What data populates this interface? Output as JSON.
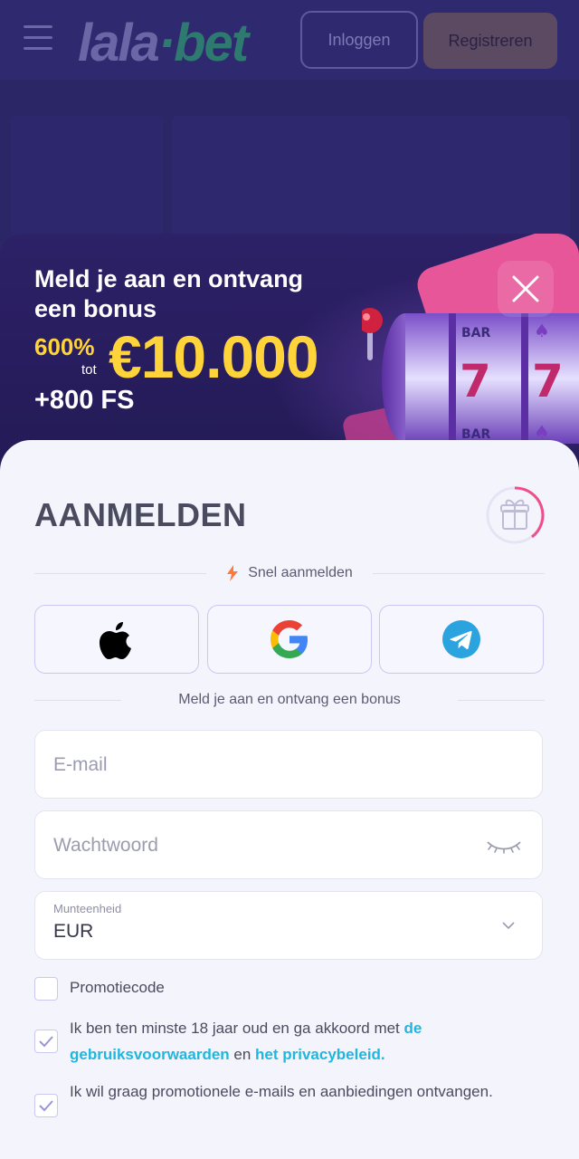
{
  "header": {
    "logo_text": "lala",
    "logo_dot": "·",
    "logo_text2": "bet",
    "login_label": "Inloggen",
    "register_label": "Registreren"
  },
  "banner": {
    "title": "Meld je aan en ontvang een bonus",
    "percent": "600%",
    "tot": "tot",
    "amount": "€10.000",
    "free_spins": "+800 FS"
  },
  "form": {
    "title": "AANMELDEN",
    "quick_label": "Snel aanmelden",
    "bonus_label": "Meld je aan en ontvang een bonus",
    "email_placeholder": "E-mail",
    "password_placeholder": "Wachtwoord",
    "currency_label": "Munteenheid",
    "currency_value": "EUR",
    "promo_label": "Promotiecode",
    "terms_text1": "Ik ben ten minste 18 jaar oud en ga akkoord met ",
    "terms_link1": "de gebruiksvoorwaarden",
    "terms_text2": " en ",
    "terms_link2": "het privacybeleid.",
    "marketing_text": "Ik wil graag promotionele e-mails en aanbiedingen ontvangen.",
    "promo_checked": false,
    "terms_checked": true,
    "marketing_checked": true
  },
  "colors": {
    "accent_yellow": "#ffd43b",
    "link_blue": "#1fb6e0",
    "banner_bg": "#2d2167",
    "pink": "#e8569a"
  },
  "icons": {
    "menu": "menu-icon",
    "close": "close-icon",
    "gift": "gift-icon",
    "lightning": "lightning-icon",
    "apple": "apple-icon",
    "google": "google-icon",
    "telegram": "telegram-icon",
    "eye": "eye-closed-icon",
    "chevron": "chevron-down-icon",
    "check": "check-icon"
  }
}
